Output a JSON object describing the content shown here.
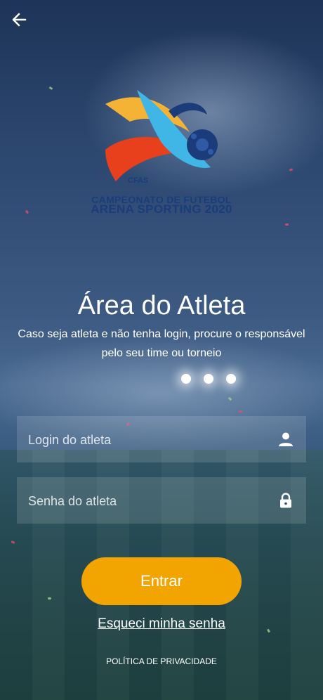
{
  "header": {
    "back_icon": "arrow-left-icon"
  },
  "logo": {
    "abbrev": "CFAS",
    "line1": "CAMPEONATO DE FUTEBOL",
    "line2": "ARENA SPORTING 2020",
    "colors": {
      "yellow": "#f5b335",
      "red": "#e8401c",
      "blue": "#3fb6e6",
      "navy": "#1b3c7a"
    }
  },
  "main": {
    "title": "Área do Atleta",
    "subtitle_line1": "Caso seja atleta e não tenha login, procure o responsável",
    "subtitle_line2": "pelo seu time ou torneio"
  },
  "form": {
    "login": {
      "placeholder": "Login do atleta",
      "value": "",
      "icon": "user-icon"
    },
    "password": {
      "placeholder": "Senha do atleta",
      "value": "",
      "icon": "lock-icon"
    },
    "submit_label": "Entrar",
    "forgot_label": "Esqueci minha senha"
  },
  "footer": {
    "privacy_label": "POLÍTICA DE PRIVACIDADE"
  },
  "colors": {
    "accent": "#f2a500",
    "text": "#ffffff"
  }
}
